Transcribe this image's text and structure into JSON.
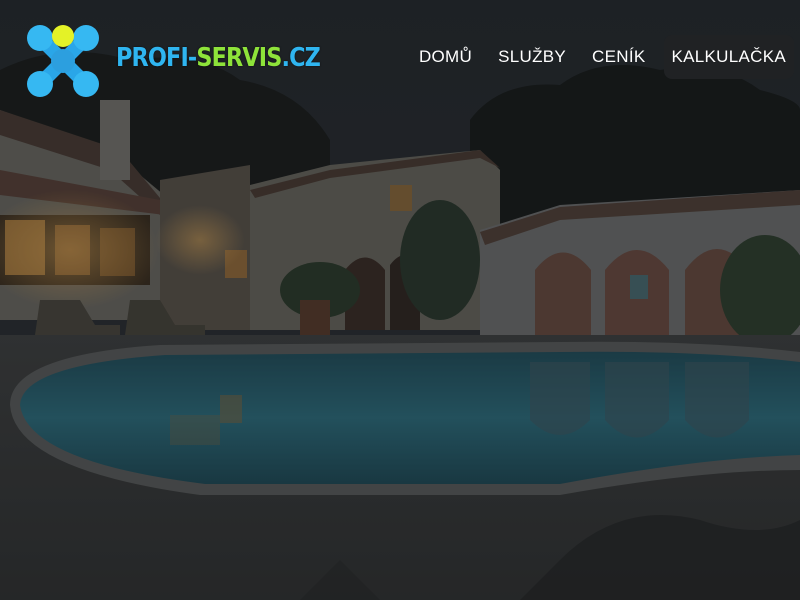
{
  "logo": {
    "text_part1": "PROFI-",
    "text_part2": "SERVIS",
    "text_part3": ".CZ",
    "colors": {
      "blue": "#2fb5f0",
      "green": "#8ee33a",
      "yellow": "#e4f227"
    },
    "icon": "x-molecule-logo-icon"
  },
  "nav": {
    "items": [
      {
        "label": "DOMŮ"
      },
      {
        "label": "SLUŽBY"
      },
      {
        "label": "CENÍK"
      },
      {
        "label": "KALKULAČKA",
        "active": true
      }
    ]
  },
  "hero": {
    "image": "night-villa-pool-photo"
  }
}
